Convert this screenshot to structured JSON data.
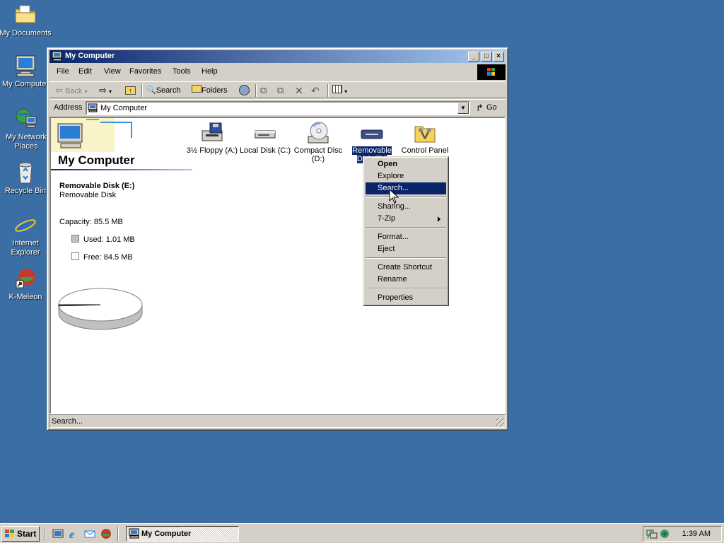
{
  "desktop": {
    "icons": [
      {
        "label": "My Documents"
      },
      {
        "label": "My Computer"
      },
      {
        "label": "My Network Places"
      },
      {
        "label": "Recycle Bin"
      },
      {
        "label": "Internet Explorer"
      },
      {
        "label": "K-Meleon"
      }
    ]
  },
  "window": {
    "title": "My Computer",
    "menu": [
      "File",
      "Edit",
      "View",
      "Favorites",
      "Tools",
      "Help"
    ],
    "toolbar": {
      "back": "Back",
      "search": "Search",
      "folders": "Folders"
    },
    "address": {
      "label": "Address",
      "value": "My Computer",
      "go": "Go"
    },
    "left_pane": {
      "title": "My Computer",
      "selected_name": "Removable Disk (E:)",
      "selected_type": "Removable Disk",
      "capacity": "Capacity: 85.5 MB",
      "used": "Used: 1.01 MB",
      "free": "Free: 84.5 MB"
    },
    "disk_usage": {
      "used_mb": 1.01,
      "free_mb": 84.5,
      "capacity_mb": 85.5
    },
    "items": [
      {
        "label": "3½ Floppy (A:)"
      },
      {
        "label": "Local Disk (C:)"
      },
      {
        "label": "Compact Disc (D:)"
      },
      {
        "label": "Removable Disk (E:)",
        "selected": true
      },
      {
        "label": "Control Panel"
      }
    ],
    "status": "Search..."
  },
  "context_menu": {
    "items": [
      {
        "label": "Open",
        "bold": true
      },
      {
        "label": "Explore"
      },
      {
        "label": "Search...",
        "highlighted": true
      },
      {
        "label": "Sharing..."
      },
      {
        "label": "7-Zip",
        "submenu": true
      },
      {
        "label": "Format..."
      },
      {
        "label": "Eject"
      },
      {
        "label": "Create Shortcut"
      },
      {
        "label": "Rename"
      },
      {
        "label": "Properties"
      }
    ]
  },
  "taskbar": {
    "start": "Start",
    "task": "My Computer",
    "clock": "1:39 AM"
  },
  "colors": {
    "desktop": "#3a6ea5",
    "title_active": "#0a246a",
    "highlight": "#0a246a"
  }
}
